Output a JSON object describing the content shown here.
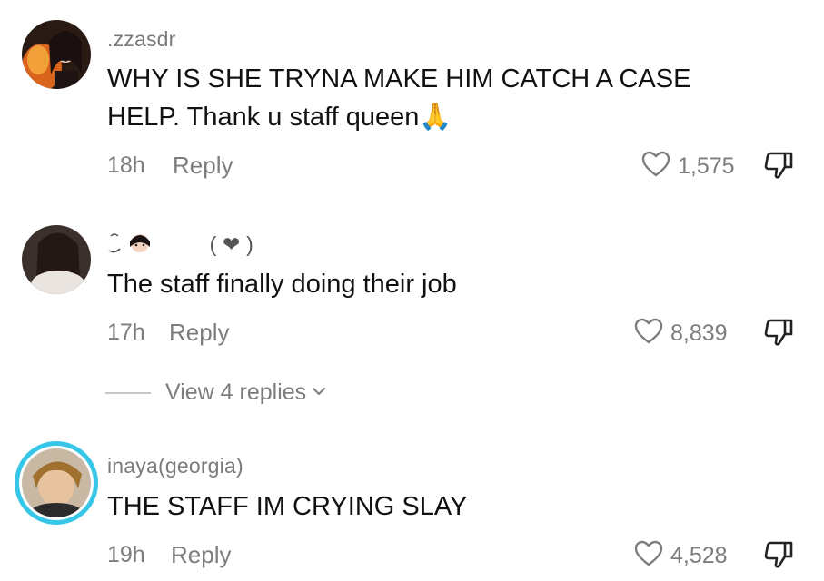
{
  "comments": [
    {
      "username": ".zzasdr",
      "text": "WHY IS SHE TRYNA MAKE HIM CATCH A CASE HELP. Thank u staff queen🙏",
      "time": "18h",
      "reply_label": "Reply",
      "likes": "1,575"
    },
    {
      "username": "( ❤ )",
      "text": "The staff finally doing their job",
      "time": "17h",
      "reply_label": "Reply",
      "likes": "8,839"
    },
    {
      "username": "inaya(georgia)",
      "text": "THE STAFF IM CRYING SLAY",
      "time": "19h",
      "reply_label": "Reply",
      "likes": "4,528"
    }
  ],
  "view_replies": {
    "label": "View 4 replies"
  },
  "colors": {
    "story_ring": "#36c7e8",
    "meta_text": "#7d7d7d"
  }
}
